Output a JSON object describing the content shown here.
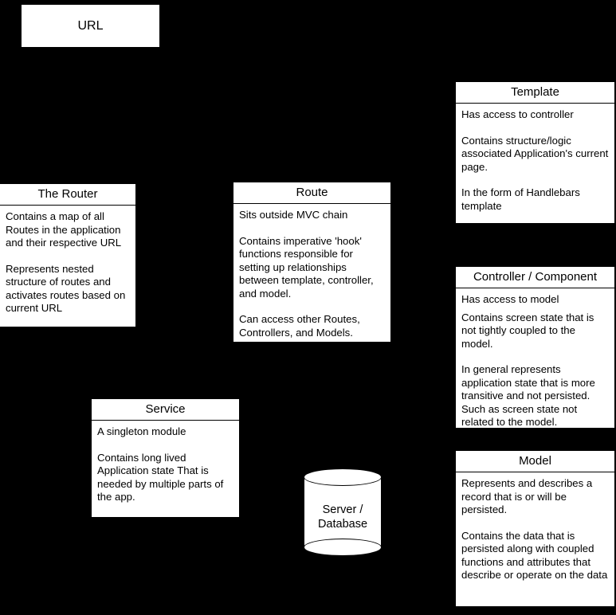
{
  "diagram": {
    "title": "Ember MVC Architecture Diagram",
    "background_color": "#000000",
    "node_fill": "#ffffff",
    "stroke_color": "#000000"
  },
  "nodes": {
    "url": {
      "label": "URL",
      "shape": "rectangle"
    },
    "router": {
      "title": "The Router",
      "shape": "class-box",
      "lines": [
        "Contains a map of all Routes in the application and their respective URL",
        "Represents nested structure of routes and activates routes based on current URL"
      ]
    },
    "route": {
      "title": "Route",
      "shape": "class-box",
      "lines": [
        "Sits outside MVC chain",
        "Contains imperative 'hook' functions responsible for setting up relationships between template, controller, and model.",
        "Can access other Routes, Controllers, and Models."
      ]
    },
    "template": {
      "title": "Template",
      "shape": "class-box",
      "lines": [
        "Has access to controller",
        "Contains structure/logic associated Application's current page.",
        "In the form of Handlebars template"
      ]
    },
    "controller": {
      "title": "Controller / Component",
      "shape": "class-box",
      "lines": [
        "Has access to model",
        "Contains screen state that is not tightly coupled to the model.",
        "In general represents application state that is more transitive and not persisted. Such as screen state not related to the model."
      ]
    },
    "service": {
      "title": "Service",
      "shape": "class-box",
      "lines": [
        "A singleton module",
        "Contains long lived Application state That is needed by multiple parts of the app."
      ]
    },
    "model": {
      "title": "Model",
      "shape": "class-box",
      "lines": [
        "Represents and describes a record that is or will be persisted.",
        "Contains the data that is persisted along with coupled functions and attributes that describe or operate on the data"
      ]
    },
    "database": {
      "label_line_1": "Server /",
      "label_line_2": "Database",
      "shape": "cylinder"
    }
  }
}
